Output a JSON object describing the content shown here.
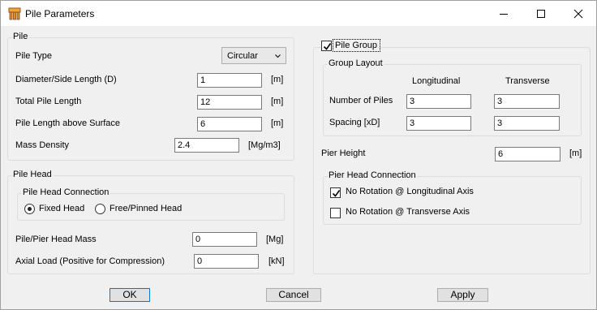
{
  "window": {
    "title": "Pile Parameters",
    "controls": [
      "minimize-icon",
      "maximize-icon",
      "close-icon"
    ]
  },
  "pile": {
    "group_label": "Pile",
    "type_label": "Pile Type",
    "type_value": "Circular",
    "diameter_label": "Diameter/Side Length (D)",
    "diameter_value": "1",
    "diameter_unit": "[m]",
    "length_label": "Total Pile Length",
    "length_value": "12",
    "length_unit": "[m]",
    "above_label": "Pile Length above Surface",
    "above_value": "6",
    "above_unit": "[m]",
    "density_label": "Mass Density",
    "density_value": "2.4",
    "density_unit": "[Mg/m3]"
  },
  "pile_head": {
    "group_label": "Pile Head",
    "connection_label": "Pile Head Connection",
    "fixed_label": "Fixed Head",
    "fixed_selected": true,
    "free_label": "Free/Pinned Head",
    "mass_label": "Pile/Pier Head Mass",
    "mass_value": "0",
    "mass_unit": "[Mg]",
    "axial_label": "Axial Load (Positive for Compression)",
    "axial_value": "0",
    "axial_unit": "[kN]"
  },
  "pile_group": {
    "checkbox_label": "Pile Group",
    "checked": true,
    "layout_label": "Group Layout",
    "col_longitudinal": "Longitudinal",
    "col_transverse": "Transverse",
    "num_label": "Number of Piles",
    "num_long": "3",
    "num_trans": "3",
    "spacing_label": "Spacing [xD]",
    "spacing_long": "3",
    "spacing_trans": "3",
    "pier_label": "Pier Height",
    "pier_value": "6",
    "pier_unit": "[m]",
    "connection_label": "Pier Head Connection",
    "no_rot_long_label": "No Rotation @ Longitudinal Axis",
    "no_rot_long_checked": true,
    "no_rot_trans_label": "No Rotation @ Transverse Axis",
    "no_rot_trans_checked": false
  },
  "buttons": {
    "ok": "OK",
    "cancel": "Cancel",
    "apply": "Apply"
  }
}
